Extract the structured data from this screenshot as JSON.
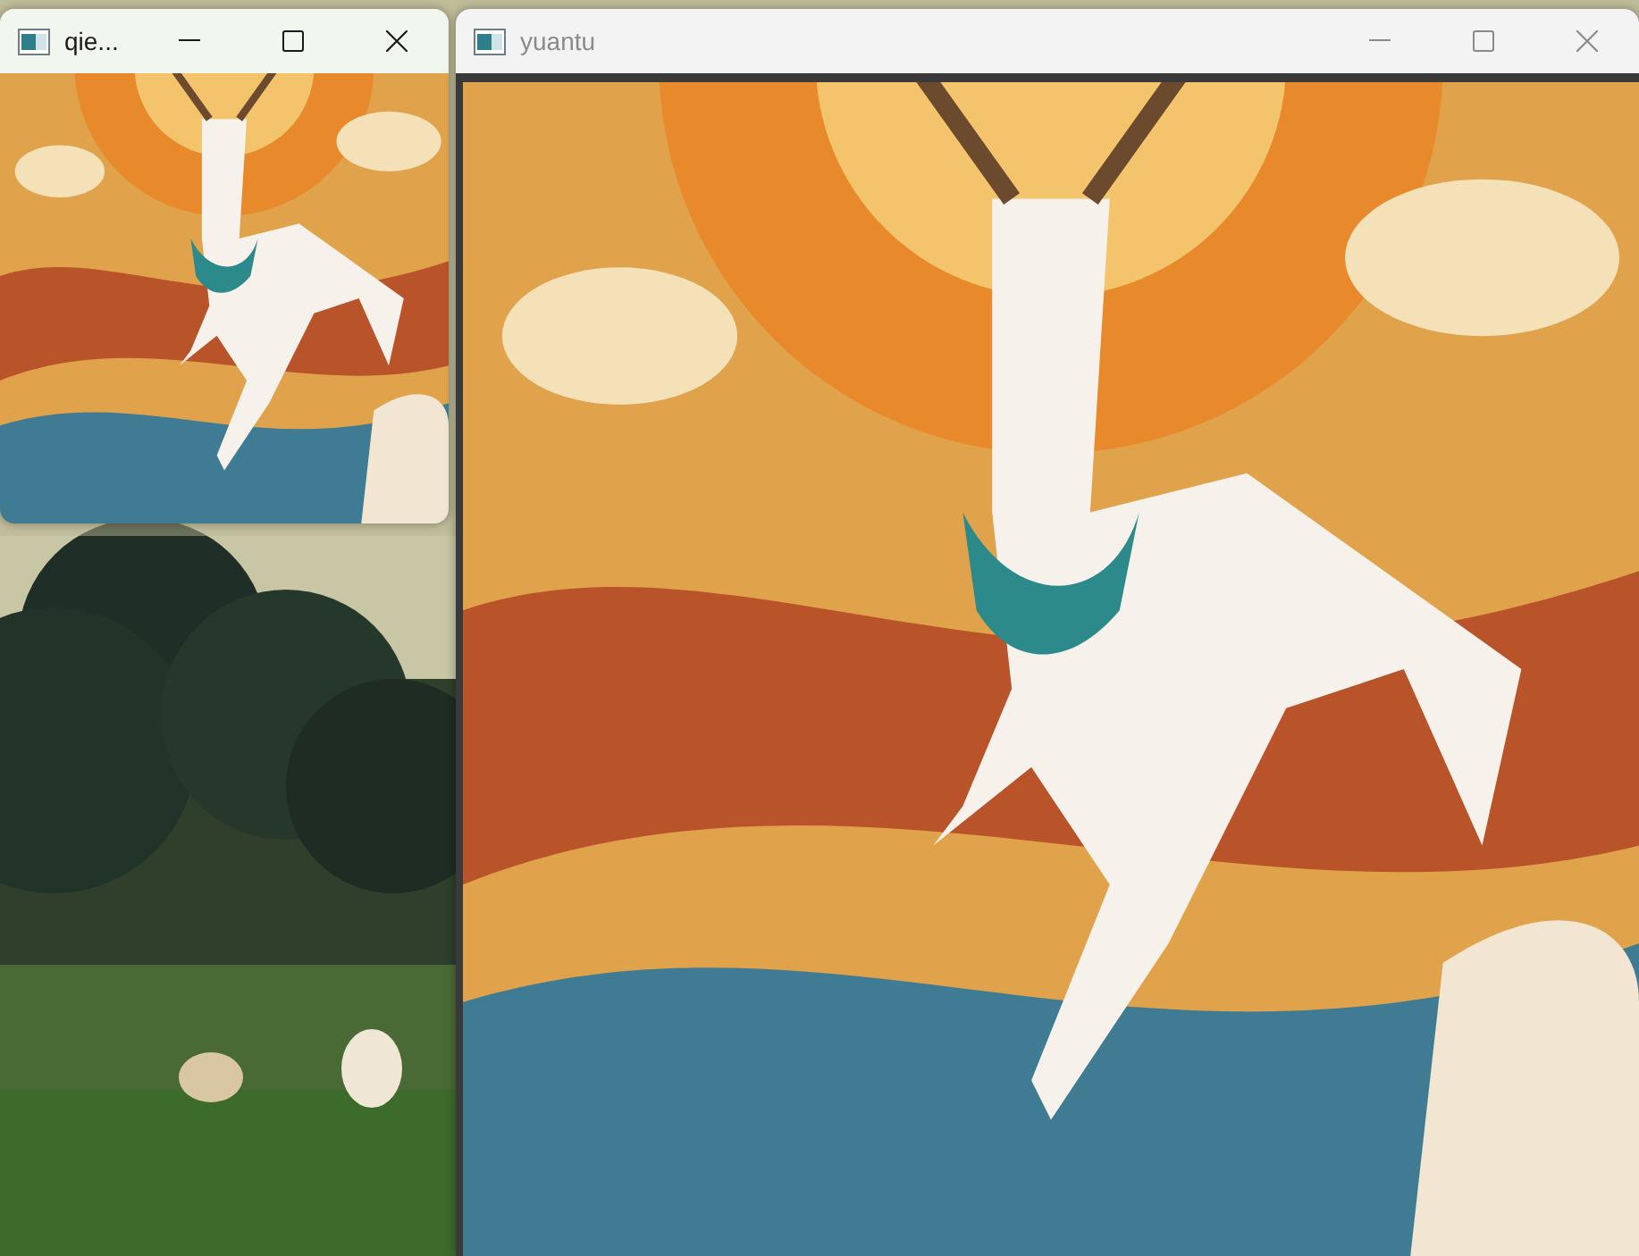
{
  "windows": [
    {
      "title": "qie...",
      "active": true
    },
    {
      "title": "yuantu",
      "active": false
    }
  ]
}
